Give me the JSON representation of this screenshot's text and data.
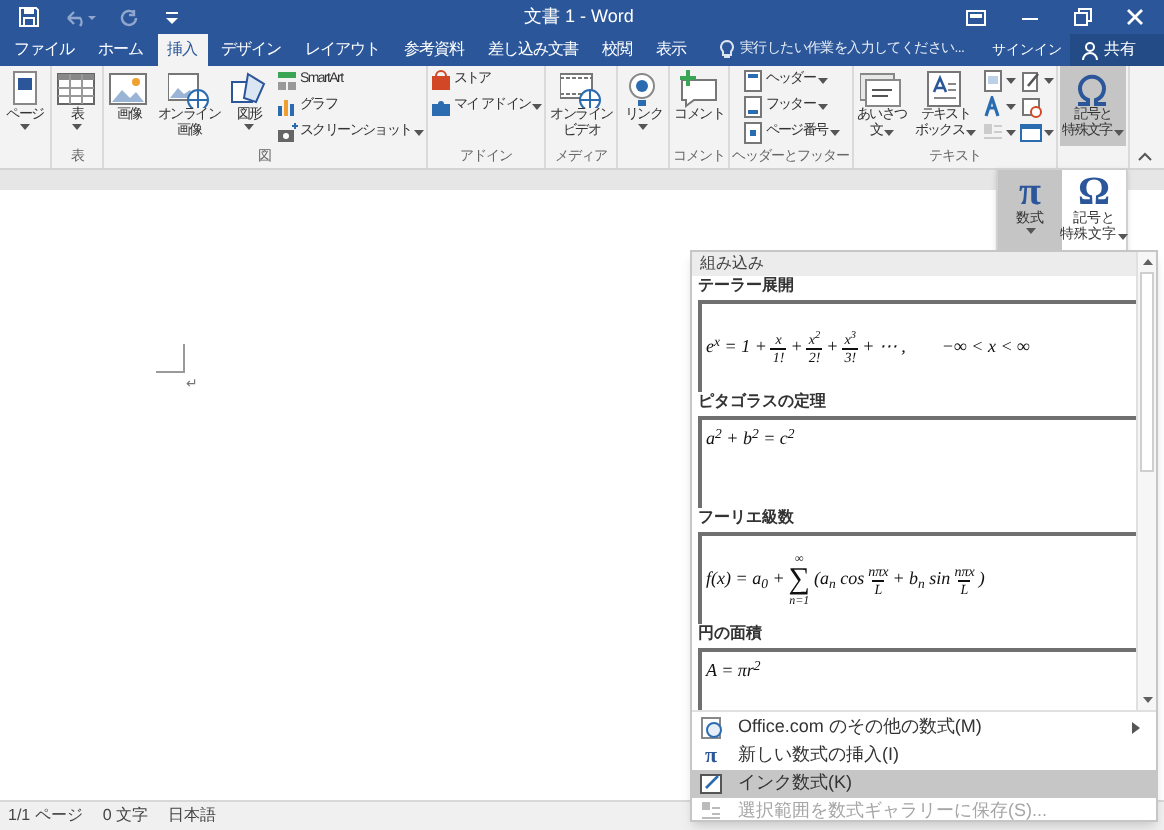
{
  "window": {
    "title": "文書 1 - Word"
  },
  "tabs": [
    {
      "label": "ファイル",
      "selected": false
    },
    {
      "label": "ホーム",
      "selected": false
    },
    {
      "label": "挿入",
      "selected": true
    },
    {
      "label": "デザイン",
      "selected": false
    },
    {
      "label": "レイアウト",
      "selected": false
    },
    {
      "label": "参考資料",
      "selected": false
    },
    {
      "label": "差し込み文書",
      "selected": false
    },
    {
      "label": "校閲",
      "selected": false
    },
    {
      "label": "表示",
      "selected": false
    }
  ],
  "tell_me": {
    "placeholder": "実行したい作業を入力してください..."
  },
  "account": {
    "sign_in": "サインイン",
    "share": "共有"
  },
  "ribbon": {
    "groups": [
      {
        "items": [
          {
            "kind": "large",
            "lines": [
              "ページ"
            ],
            "dropdown": true,
            "pressed": false
          }
        ]
      },
      {
        "label": "表",
        "items": [
          {
            "kind": "large",
            "lines": [
              "表"
            ],
            "dropdown": true,
            "pressed": false
          }
        ]
      },
      {
        "label": "図",
        "items": [
          {
            "kind": "large",
            "lines": [
              "画像"
            ],
            "dropdown": false,
            "pressed": false
          },
          {
            "kind": "large",
            "lines": [
              "オンライン",
              "画像"
            ],
            "dropdown": false,
            "pressed": false
          },
          {
            "kind": "large",
            "lines": [
              "図形"
            ],
            "dropdown": true,
            "pressed": false
          },
          {
            "kind": "column",
            "items": [
              {
                "kind": "small",
                "label": "SmartArt",
                "dropdown": false,
                "pressed": false
              },
              {
                "kind": "small",
                "label": "グラフ",
                "dropdown": false,
                "pressed": false
              },
              {
                "kind": "small",
                "label": "スクリーンショット",
                "dropdown": true,
                "pressed": false
              }
            ]
          }
        ]
      },
      {
        "label": "アドイン",
        "items": [
          {
            "kind": "column",
            "items": [
              {
                "kind": "small",
                "label": "ストア",
                "dropdown": false,
                "pressed": false
              },
              {
                "kind": "small",
                "label": "マイ アドイン",
                "dropdown": true,
                "pressed": false
              }
            ]
          }
        ]
      },
      {
        "label": "メディア",
        "items": [
          {
            "kind": "large",
            "lines": [
              "オンライン",
              "ビデオ"
            ],
            "dropdown": false,
            "pressed": false
          }
        ]
      },
      {
        "items": [
          {
            "kind": "large",
            "lines": [
              "リンク"
            ],
            "dropdown": true,
            "pressed": false
          }
        ]
      },
      {
        "label": "コメント",
        "items": [
          {
            "kind": "large",
            "lines": [
              "コメント"
            ],
            "dropdown": false,
            "pressed": false
          }
        ]
      },
      {
        "label": "ヘッダーとフッター",
        "items": [
          {
            "kind": "column",
            "items": [
              {
                "kind": "small",
                "label": "ヘッダー",
                "dropdown": true,
                "pressed": false
              },
              {
                "kind": "small",
                "label": "フッター",
                "dropdown": true,
                "pressed": false
              },
              {
                "kind": "small",
                "label": "ページ番号",
                "dropdown": true,
                "pressed": false
              }
            ]
          }
        ]
      },
      {
        "label": "テキスト",
        "items": [
          {
            "kind": "large",
            "lines": [
              "あいさつ",
              "文"
            ],
            "dropdown": true,
            "pressed": false
          },
          {
            "kind": "large",
            "lines": [
              "テキスト",
              "ボックス"
            ],
            "dropdown": true,
            "pressed": false
          },
          {
            "kind": "column",
            "items": [
              {
                "kind": "icon",
                "dropdown": true,
                "pressed": false
              },
              {
                "kind": "icon",
                "dropdown": true,
                "pressed": false
              },
              {
                "kind": "icon",
                "dropdown": true,
                "pressed": false
              }
            ]
          },
          {
            "kind": "column",
            "items": [
              {
                "kind": "icon",
                "dropdown": true,
                "pressed": false
              },
              {
                "kind": "icon",
                "dropdown": false,
                "pressed": false
              },
              {
                "kind": "icon",
                "dropdown": true,
                "pressed": false
              }
            ]
          }
        ]
      },
      {
        "items": [
          {
            "kind": "large",
            "lines": [
              "記号と",
              "特殊文字"
            ],
            "dropdown": true,
            "pressed": true
          }
        ]
      }
    ]
  },
  "symbols_menu": {
    "buttons": [
      {
        "symbol": "π",
        "lines": [
          "数式"
        ],
        "dropdown": true,
        "selected": true
      },
      {
        "symbol": "Ω",
        "lines": [
          "記号と",
          "特殊文字"
        ],
        "dropdown": true,
        "selected": false
      }
    ]
  },
  "equation_gallery": {
    "header": "組み込み",
    "equations": [
      {
        "title": "テーラー展開",
        "formula": [
          {
            "kind": "text",
            "text": "e$^{x}$ = 1 +"
          },
          {
            "kind": "frac",
            "num": "x",
            "den": "1!"
          },
          {
            "kind": "text",
            "text": "+"
          },
          {
            "kind": "frac",
            "num": "x$^{2}$",
            "den": "2!"
          },
          {
            "kind": "text",
            "text": "+"
          },
          {
            "kind": "frac",
            "num": "x$^{3}$",
            "den": "3!"
          },
          {
            "kind": "text",
            "text": "+ ⋯ ,"
          },
          {
            "kind": "gap"
          },
          {
            "kind": "text",
            "text": "−∞ < x < ∞"
          }
        ]
      },
      {
        "title": "ピタゴラスの定理",
        "formula": [
          {
            "kind": "text",
            "text": "a$^{2}$ + b$^{2}$ = c$^{2}$"
          }
        ]
      },
      {
        "title": "フーリエ級数",
        "formula": [
          {
            "kind": "text",
            "text": "f(x) = a$_{0}$ +"
          },
          {
            "kind": "sum",
            "symbol": "∑",
            "top": "∞",
            "bottom": "n=1"
          },
          {
            "kind": "text",
            "text": "(a$_{n}$ cos"
          },
          {
            "kind": "frac",
            "num": "nπx",
            "den": "L"
          },
          {
            "kind": "text",
            "text": "+ b$_{n}$ sin"
          },
          {
            "kind": "frac",
            "num": "nπx",
            "den": "L"
          },
          {
            "kind": "text",
            "text": ")"
          }
        ]
      },
      {
        "title": "円の面積",
        "formula": [
          {
            "kind": "text",
            "text": "A = πr$^{2}$"
          }
        ]
      }
    ],
    "commands": [
      {
        "kind": "web",
        "label": "Office.com のその他の数式(M)",
        "submenu": true,
        "highlighted": false,
        "disabled": false
      },
      {
        "kind": "new",
        "symbol": "π",
        "label": "新しい数式の挿入(I)",
        "submenu": false,
        "highlighted": false,
        "disabled": false
      },
      {
        "kind": "ink",
        "label": "インク数式(K)",
        "submenu": false,
        "highlighted": true,
        "disabled": false
      },
      {
        "kind": "save",
        "label": "選択範囲を数式ギャラリーに保存(S)...",
        "submenu": false,
        "highlighted": false,
        "disabled": true
      }
    ]
  },
  "document": {
    "paragraph_mark": "↵"
  },
  "status_bar": [
    "1/1 ページ",
    "0 文字",
    "日本語"
  ]
}
